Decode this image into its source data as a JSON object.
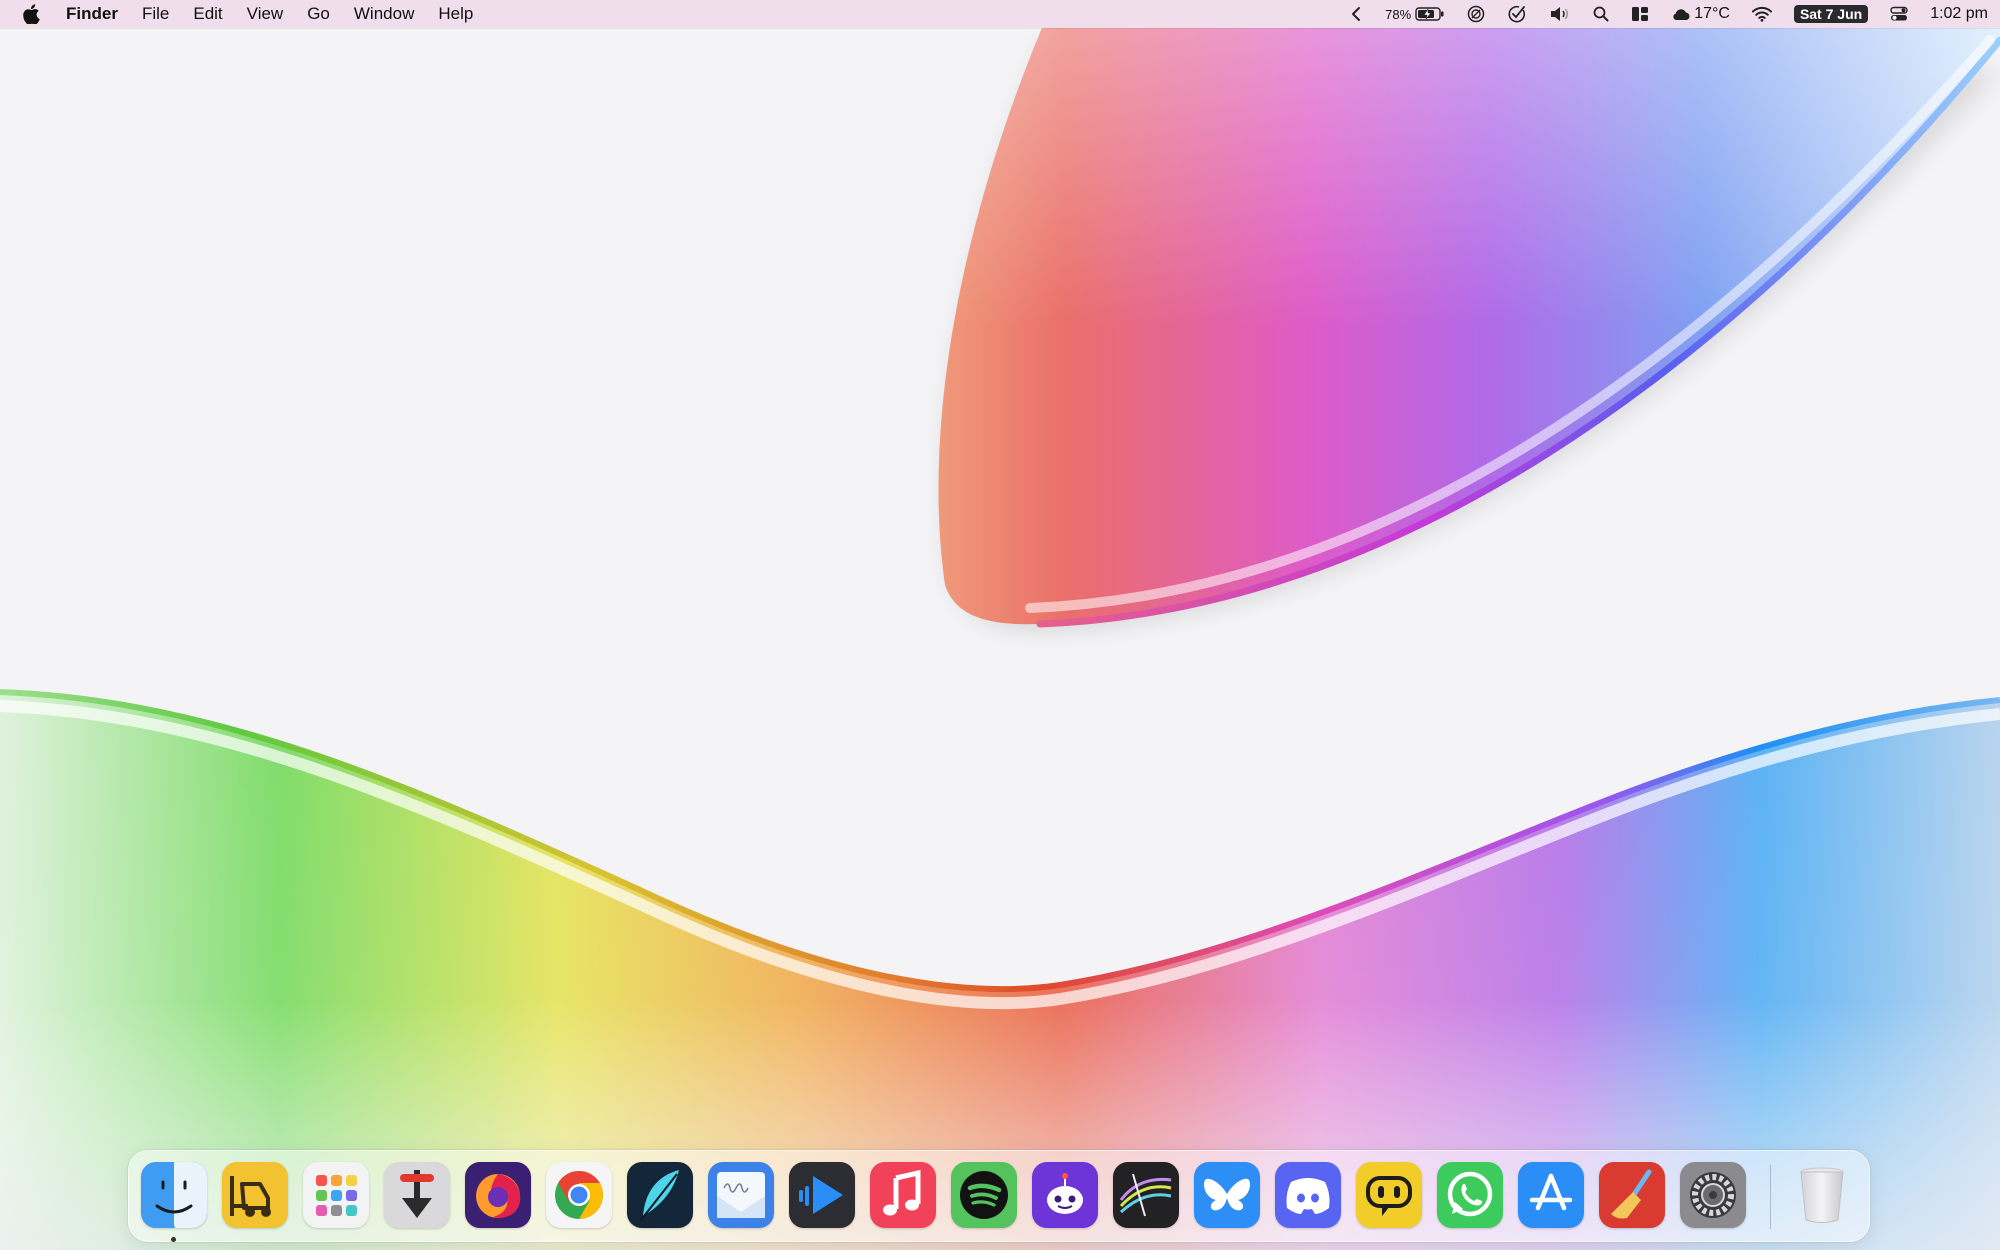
{
  "menubar": {
    "app_name": "Finder",
    "menus": [
      "File",
      "Edit",
      "View",
      "Go",
      "Window",
      "Help"
    ],
    "status": {
      "battery_percent": "78%",
      "weather_temp": "17°C",
      "date": "Sat 7 Jun",
      "time": "1:02 pm"
    },
    "icons": [
      "apple-logo-icon",
      "chevron-left-icon",
      "battery-charging-icon",
      "focus-icon",
      "checkmark-circle-icon",
      "volume-icon",
      "search-icon",
      "widgets-icon",
      "cloud-icon",
      "wifi-icon",
      "control-center-icon"
    ]
  },
  "dock": {
    "apps": [
      {
        "id": "finder",
        "icon": "finder-icon",
        "color": "#3f9cf0"
      },
      {
        "id": "forklift",
        "icon": "forklift-icon",
        "color": "#f2c230"
      },
      {
        "id": "launchpad",
        "icon": "launchpad-icon",
        "color": "#f3f3f3"
      },
      {
        "id": "downloader",
        "icon": "download-arrow-icon",
        "color": "#d9d9db"
      },
      {
        "id": "firefox",
        "icon": "firefox-icon",
        "color": "#3a1f72"
      },
      {
        "id": "chrome",
        "icon": "chrome-icon",
        "color": "#f5f5f5"
      },
      {
        "id": "feather",
        "icon": "feather-icon",
        "color": "#13263a"
      },
      {
        "id": "mail-signature",
        "icon": "envelope-icon",
        "color": "#3c82e8"
      },
      {
        "id": "infuse",
        "icon": "play-icon",
        "color": "#2b2d33"
      },
      {
        "id": "music",
        "icon": "music-note-icon",
        "color": "#f2425a"
      },
      {
        "id": "spotify",
        "icon": "spotify-icon",
        "color": "#55c35d"
      },
      {
        "id": "reddit-client",
        "icon": "robot-icon",
        "color": "#6d35d8"
      },
      {
        "id": "lines-app",
        "icon": "lines-icon",
        "color": "#222225"
      },
      {
        "id": "bluesky",
        "icon": "butterfly-icon",
        "color": "#2d8ef5"
      },
      {
        "id": "discord",
        "icon": "discord-icon",
        "color": "#5865f2"
      },
      {
        "id": "speech-app",
        "icon": "speech-bubble-icon",
        "color": "#f2cc28"
      },
      {
        "id": "whatsapp",
        "icon": "whatsapp-icon",
        "color": "#3ecb5e"
      },
      {
        "id": "app-store",
        "icon": "app-store-icon",
        "color": "#2a8ef6"
      },
      {
        "id": "cleaner",
        "icon": "broom-icon",
        "color": "#d93b30"
      },
      {
        "id": "system-settings",
        "icon": "gear-icon",
        "color": "#8a8a8f"
      },
      {
        "id": "trash",
        "icon": "trash-icon",
        "color": "#e6e6e8"
      }
    ]
  }
}
